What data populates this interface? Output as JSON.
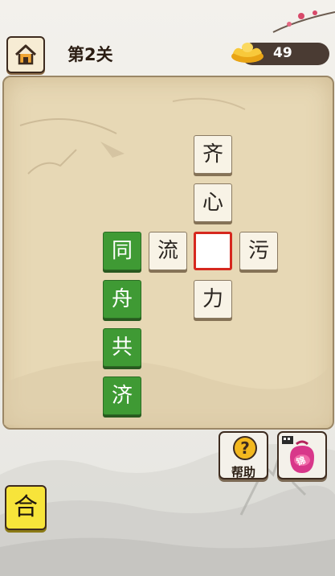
{
  "header": {
    "level_title": "第2关",
    "coins": "49",
    "home_icon": "home-icon",
    "coin_icon": "gold-ingot-icon"
  },
  "puzzle": {
    "tiles": [
      {
        "char": "齐",
        "state": "given"
      },
      {
        "char": "心",
        "state": "given"
      },
      {
        "char": "流",
        "state": "given"
      },
      {
        "char": "",
        "state": "target"
      },
      {
        "char": "污",
        "state": "given"
      },
      {
        "char": "力",
        "state": "given"
      },
      {
        "char": "同",
        "state": "solved"
      },
      {
        "char": "舟",
        "state": "solved"
      },
      {
        "char": "共",
        "state": "solved"
      },
      {
        "char": "济",
        "state": "solved"
      }
    ]
  },
  "controls": {
    "help_label": "帮助",
    "help_icon": "question-mark-icon",
    "gift_label": "锦",
    "gift_icon": "lucky-bag-icon",
    "combine_label": "合"
  },
  "colors": {
    "solved_green": "#3f9a34",
    "target_red": "#d6281e",
    "board_paper": "#e7d8b5",
    "combine_yellow": "#f7e43a"
  }
}
